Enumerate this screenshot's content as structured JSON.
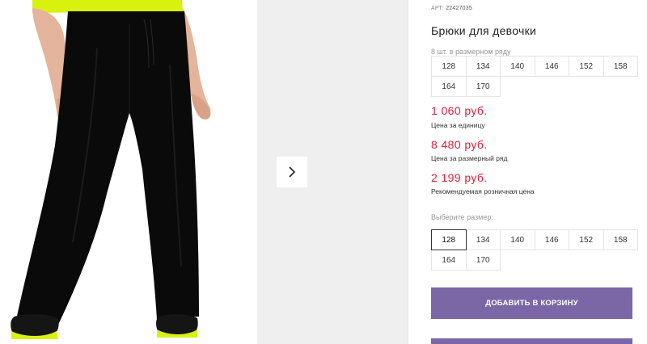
{
  "product": {
    "article_prefix": "АРТ:",
    "article_number": "22427035",
    "title": "Брюки для девочки",
    "image_alt": "Черные широкие брюки на модели"
  },
  "size_row": {
    "caption": "8 шт. в размерном ряду",
    "sizes": [
      "128",
      "134",
      "140",
      "146",
      "152",
      "158",
      "164",
      "170"
    ]
  },
  "prices": [
    {
      "value": "1 060 руб.",
      "label": "Цена за единицу"
    },
    {
      "value": "8 480 руб.",
      "label": "Цена за размерный ряд"
    },
    {
      "value": "2 199 руб.",
      "label": "Рекомендуемая розничная цена"
    }
  ],
  "size_select": {
    "label": "Выберите размер:",
    "sizes": [
      "128",
      "134",
      "140",
      "146",
      "152",
      "158",
      "164",
      "170"
    ],
    "selected": "128"
  },
  "actions": {
    "add_to_cart": "ДОБАВИТЬ В КОРЗИНУ"
  },
  "colors": {
    "price": "#e31e3b",
    "button": "#7b67a6",
    "top_garment": "#d8f20e",
    "trousers": "#0a0a0a"
  },
  "icons": {
    "next": "chevron-right-icon"
  }
}
